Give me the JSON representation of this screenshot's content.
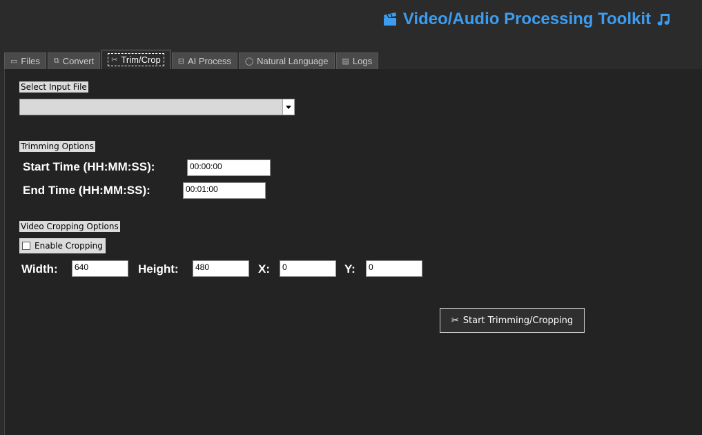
{
  "app": {
    "title": "Video/Audio Processing Toolkit",
    "title_left_icon": "clapperboard-icon",
    "title_right_icon": "music-note-icon",
    "accent_color": "#3c9df0"
  },
  "tabs": [
    {
      "label": "Files",
      "icon": "folder-icon"
    },
    {
      "label": "Convert",
      "icon": "convert-icon"
    },
    {
      "label": "Trim/Crop",
      "icon": "scissors-icon",
      "active": true
    },
    {
      "label": "AI Process",
      "icon": "robot-icon"
    },
    {
      "label": "Natural Language",
      "icon": "chat-icon"
    },
    {
      "label": "Logs",
      "icon": "log-icon"
    }
  ],
  "input_section": {
    "label": "Select Input File",
    "selected_value": ""
  },
  "trimming": {
    "label": "Trimming Options",
    "start_label": "Start Time (HH:MM:SS):",
    "start_value": "00:00:00",
    "end_label": "End Time (HH:MM:SS):",
    "end_value": "00:01:00"
  },
  "cropping": {
    "label": "Video Cropping Options",
    "enable_label": "Enable Cropping",
    "enable_checked": false,
    "width_label": "Width:",
    "width_value": "640",
    "height_label": "Height:",
    "height_value": "480",
    "x_label": "X:",
    "x_value": "0",
    "y_label": "Y:",
    "y_value": "0"
  },
  "action": {
    "label": "Start Trimming/Cropping",
    "icon": "scissors-icon"
  }
}
